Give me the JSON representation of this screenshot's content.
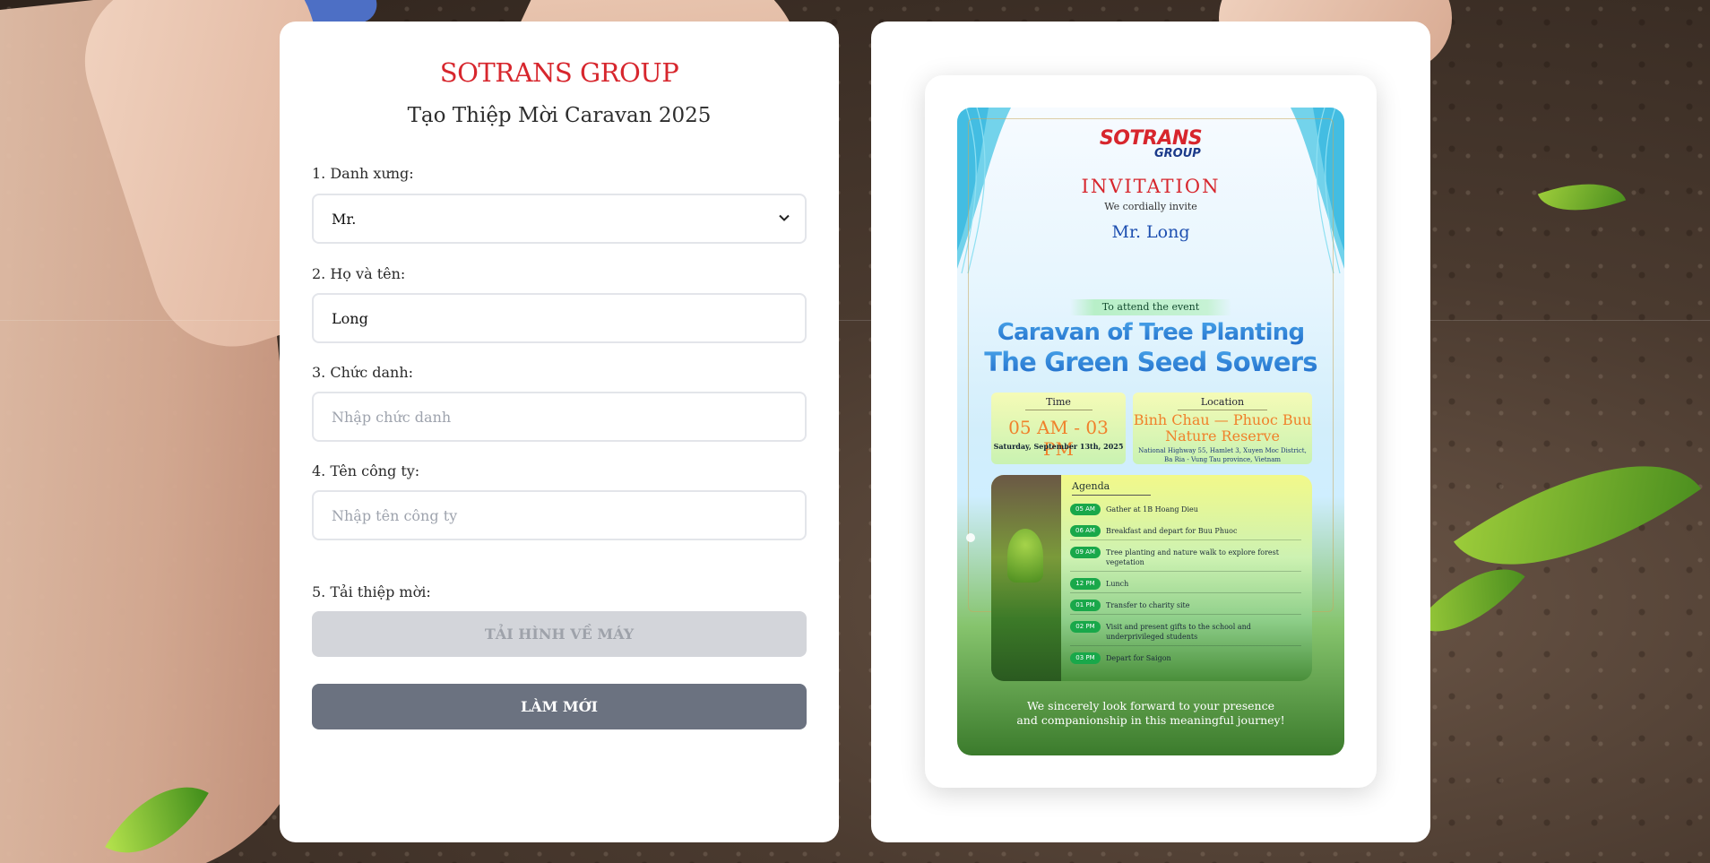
{
  "form": {
    "brand": "SOTRANS GROUP",
    "title": "Tạo Thiệp Mời Caravan 2025",
    "fields": {
      "salutation": {
        "label": "1. Danh xưng:",
        "value": "Mr."
      },
      "fullname": {
        "label": "2. Họ và tên:",
        "value": "Long"
      },
      "position": {
        "label": "3. Chức danh:",
        "placeholder": "Nhập chức danh"
      },
      "company": {
        "label": "4. Tên công ty:",
        "placeholder": "Nhập tên công ty"
      }
    },
    "download": {
      "label": "5. Tải thiệp mời:",
      "button": "TẢI HÌNH VỀ MÁY"
    },
    "reset_button": "LÀM MỚI"
  },
  "card": {
    "logo_main": "SOTRANS",
    "logo_sub": "GROUP",
    "heading": "INVITATION",
    "cordial": "We cordially invite",
    "guest": "Mr. Long",
    "attend": "To attend the event",
    "title_line1": "Caravan of Tree Planting",
    "title_line2": "The Green Seed Sowers",
    "time": {
      "label": "Time",
      "value": "05 AM - 03 PM",
      "date": "Saturday, September 13th, 2025"
    },
    "location": {
      "label": "Location",
      "line1": "Binh Chau — Phuoc Buu",
      "line2": "Nature Reserve",
      "address1": "National Highway 55, Hamlet 3, Xuyen Moc District,",
      "address2": "Ba Ria - Vung Tau province, Vietnam"
    },
    "agenda": {
      "title": "Agenda",
      "items": [
        {
          "time": "05 AM",
          "text": "Gather at 1B Hoang Dieu"
        },
        {
          "time": "06 AM",
          "text": "Breakfast and depart for Buu Phuoc"
        },
        {
          "time": "09 AM",
          "text": "Tree planting and nature walk to explore forest vegetation"
        },
        {
          "time": "12 PM",
          "text": "Lunch"
        },
        {
          "time": "01 PM",
          "text": "Transfer to charity site"
        },
        {
          "time": "02 PM",
          "text": "Visit and present gifts to the school and underprivileged students"
        },
        {
          "time": "03 PM",
          "text": "Depart for Saigon"
        }
      ]
    },
    "closing_line1": "We sincerely look forward to your presence",
    "closing_line2": "and companionship in this meaningful journey!"
  },
  "colors": {
    "brand_red": "#d7262d",
    "accent_blue": "#1d4fb0",
    "accent_orange": "#f0812b",
    "pill_green": "#19a84a",
    "reset_gray": "#6b7280",
    "disabled_gray": "#d3d5da"
  },
  "icons": {
    "select": "chevron-down-icon"
  }
}
